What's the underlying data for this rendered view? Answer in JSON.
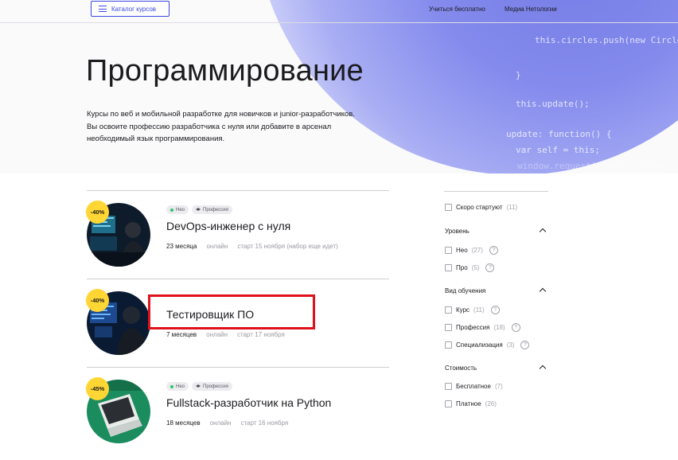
{
  "header": {
    "catalog_label": "Каталог курсов",
    "nav": [
      "Учиться бесплатно",
      "Медиа Нетологии"
    ]
  },
  "hero": {
    "title": "Программирование",
    "description": "Курсы по веб и мобильной разработке для новичков и junior-разработчиков. Вы освоите профессию разработчика с нуля или добавите в арсенал необходимый язык программирования.",
    "code_lines": [
      "this.circles.push(new Circle",
      "}",
      "this.update();",
      "update: function() {",
      "var self = this;",
      "window.requestAnimationFrame"
    ]
  },
  "courses": [
    {
      "discount": "-40%",
      "badge_neo": "Нео",
      "badge_type": "Профессия",
      "title": "DevOps-инженер с нуля",
      "duration": "23 месяца",
      "format": "онлайн",
      "start": "старт 15 ноября (набор еще идет)"
    },
    {
      "discount": "-40%",
      "badge_neo": "",
      "badge_type": "",
      "title": "Тестировщик ПО",
      "duration": "7 месяцев",
      "format": "онлайн",
      "start": "старт 17 ноября"
    },
    {
      "discount": "-45%",
      "badge_neo": "Нео",
      "badge_type": "Профессия",
      "title": "Fullstack-разработчик на Python",
      "duration": "18 месяцев",
      "format": "онлайн",
      "start": "старт 16 ноября"
    }
  ],
  "filters": {
    "soon": {
      "label": "Скоро стартуют",
      "count": "(11)"
    },
    "level": {
      "heading": "Уровень",
      "items": [
        {
          "label": "Нео",
          "count": "(27)",
          "help": "?"
        },
        {
          "label": "Про",
          "count": "(5)",
          "help": "?"
        }
      ]
    },
    "study_type": {
      "heading": "Вид обучения",
      "items": [
        {
          "label": "Курс",
          "count": "(11)",
          "help": "?"
        },
        {
          "label": "Профессия",
          "count": "(18)",
          "help": "?"
        },
        {
          "label": "Специализация",
          "count": "(3)",
          "help": "?"
        }
      ]
    },
    "cost": {
      "heading": "Стоимость",
      "items": [
        {
          "label": "Бесплатное",
          "count": "(7)"
        },
        {
          "label": "Платное",
          "count": "(26)"
        }
      ]
    }
  },
  "colors": {
    "accent": "#3b48e0",
    "discount_badge": "#ffd633",
    "highlight": "#e0111b",
    "neo_dot": "#2bc46a"
  }
}
